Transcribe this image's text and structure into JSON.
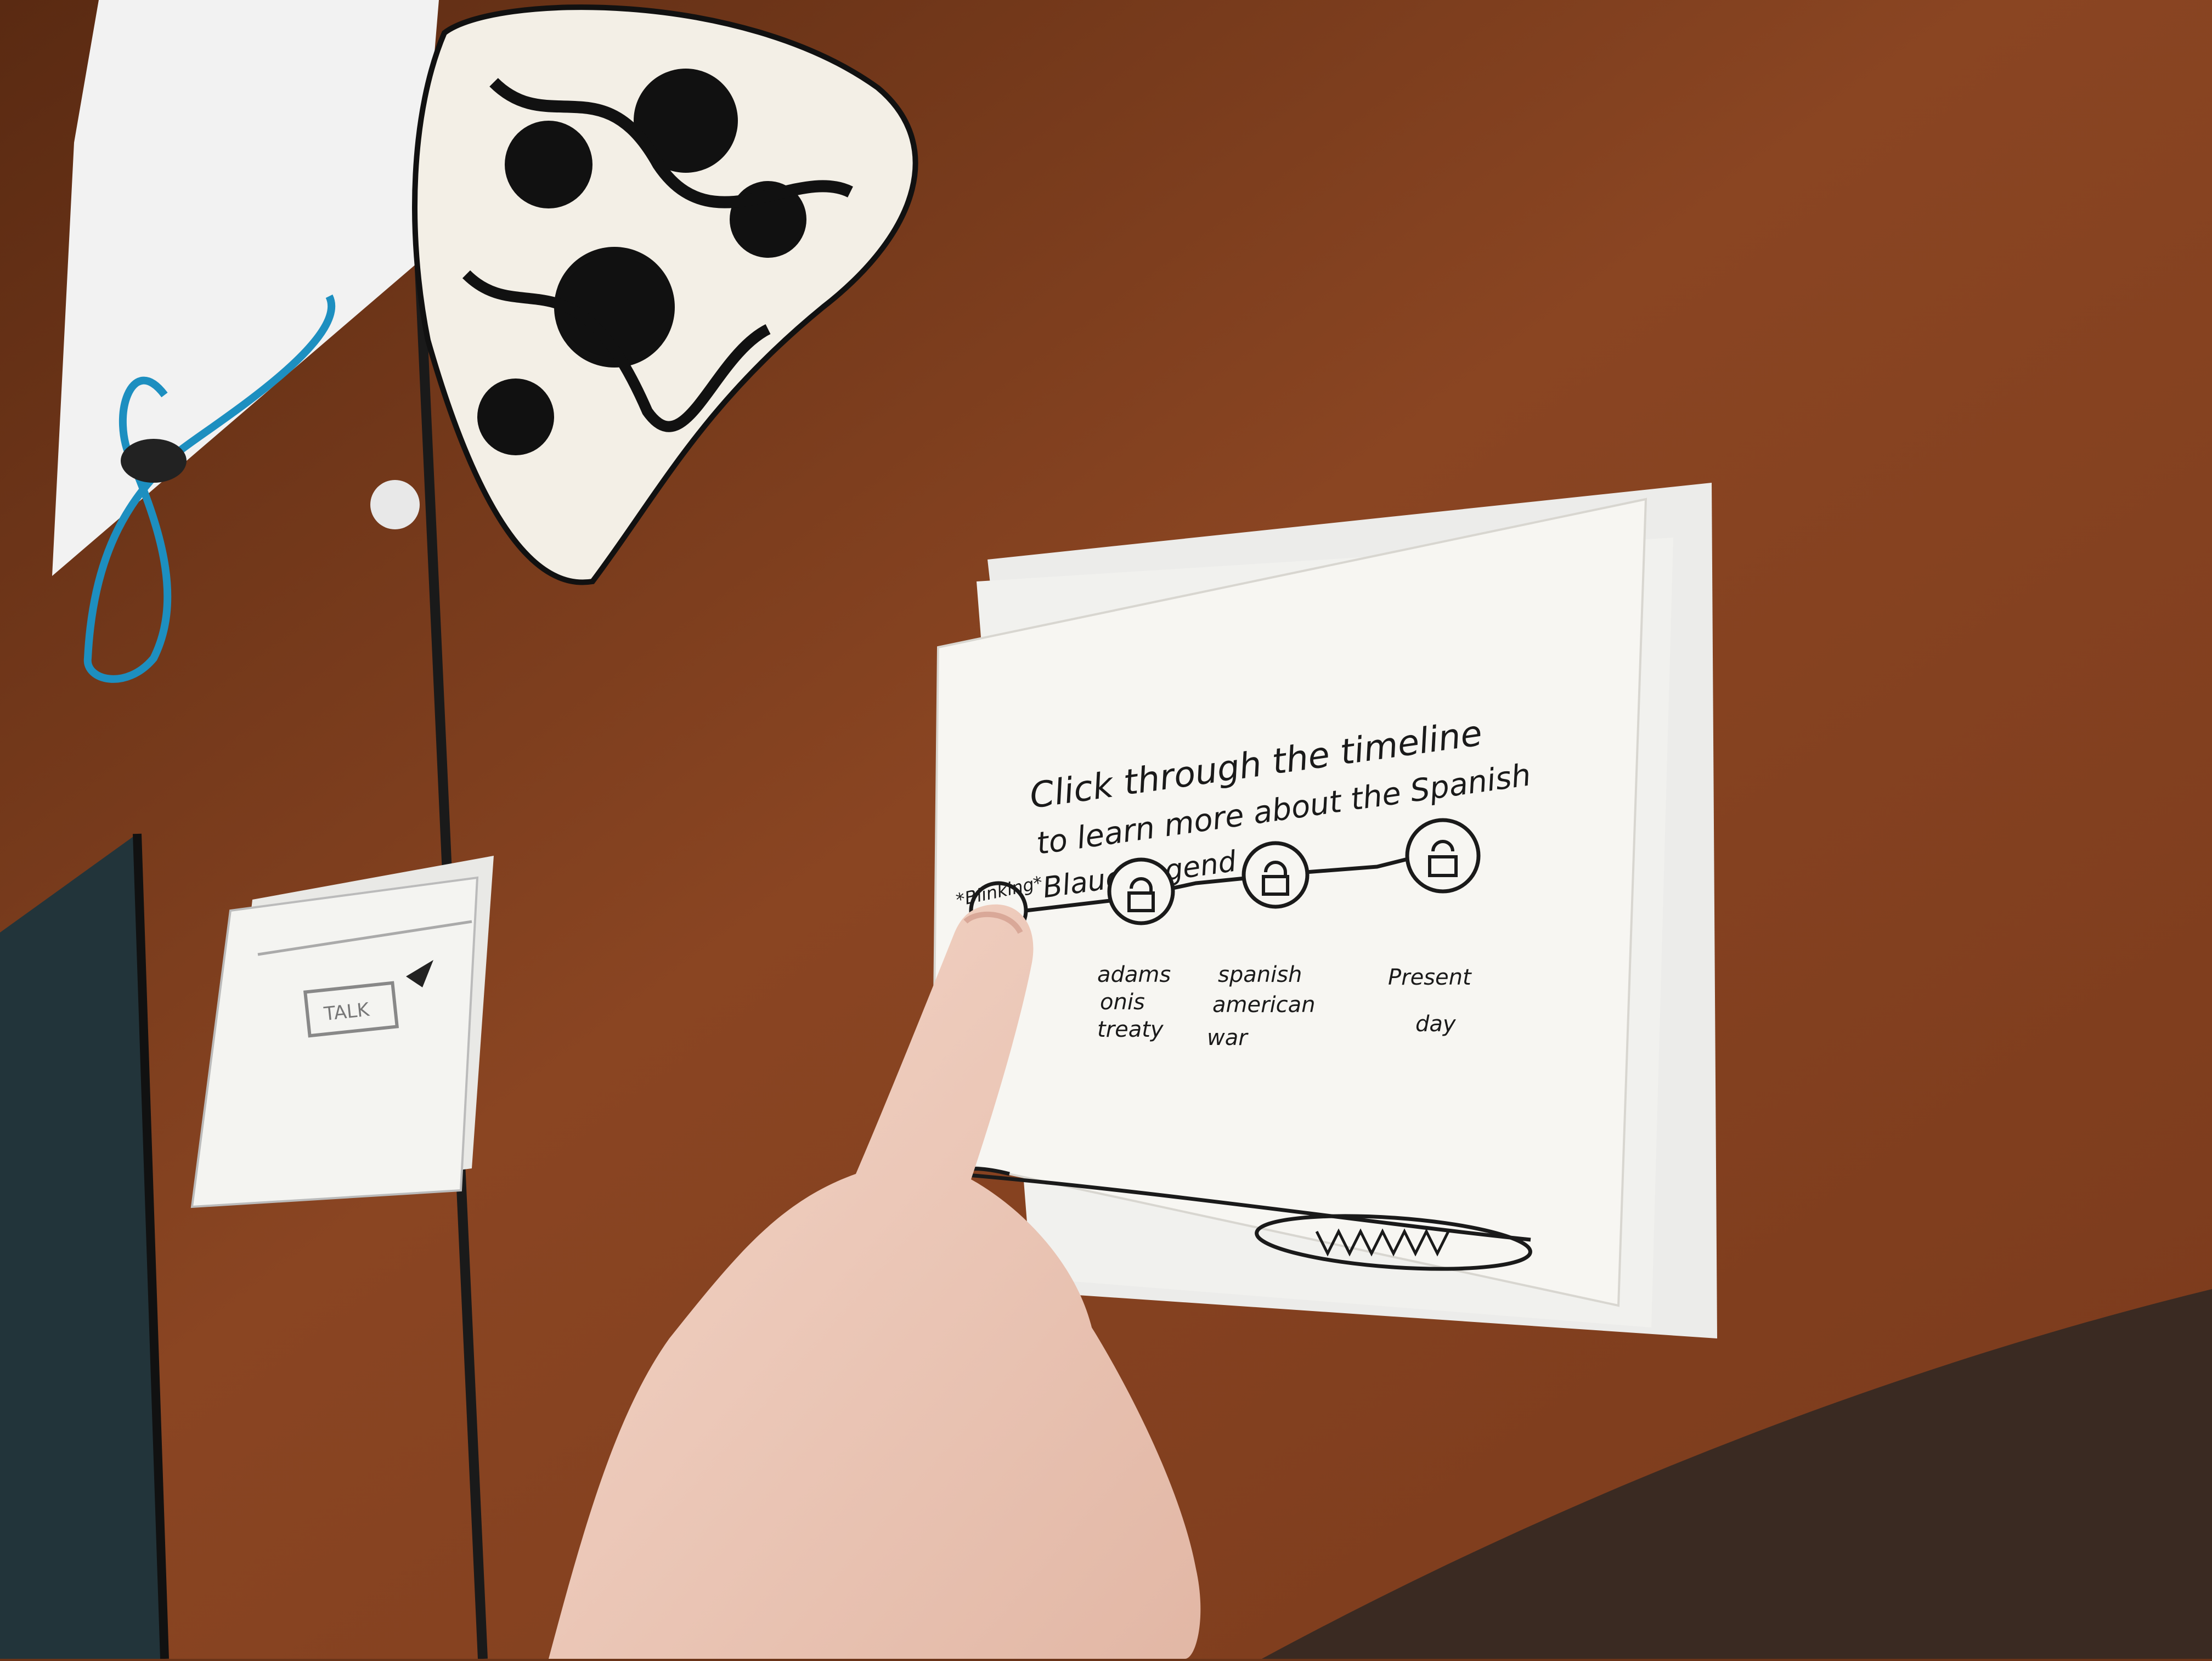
{
  "sketch": {
    "instruction_line1": "Click through the timeline",
    "instruction_line2": "to learn more about the Spanish",
    "instruction_line3": "Blaue Legend",
    "blinking_note": "*Blinking*",
    "milestones": [
      {
        "label_lines": [
          ""
        ],
        "locked": false
      },
      {
        "label_lines": [
          "adams",
          "onis",
          "treaty"
        ],
        "locked": true
      },
      {
        "label_lines": [
          "spanish",
          "american",
          "war"
        ],
        "locked": true
      },
      {
        "label_lines": [
          "Present",
          "day"
        ],
        "locked": true
      }
    ]
  },
  "small_sketch": {
    "button_label": "TALK"
  },
  "colors": {
    "desk": "#8a4522",
    "paper": "#f7f6f2",
    "ink": "#1a1a1a",
    "cable": "#1d8fc0"
  }
}
